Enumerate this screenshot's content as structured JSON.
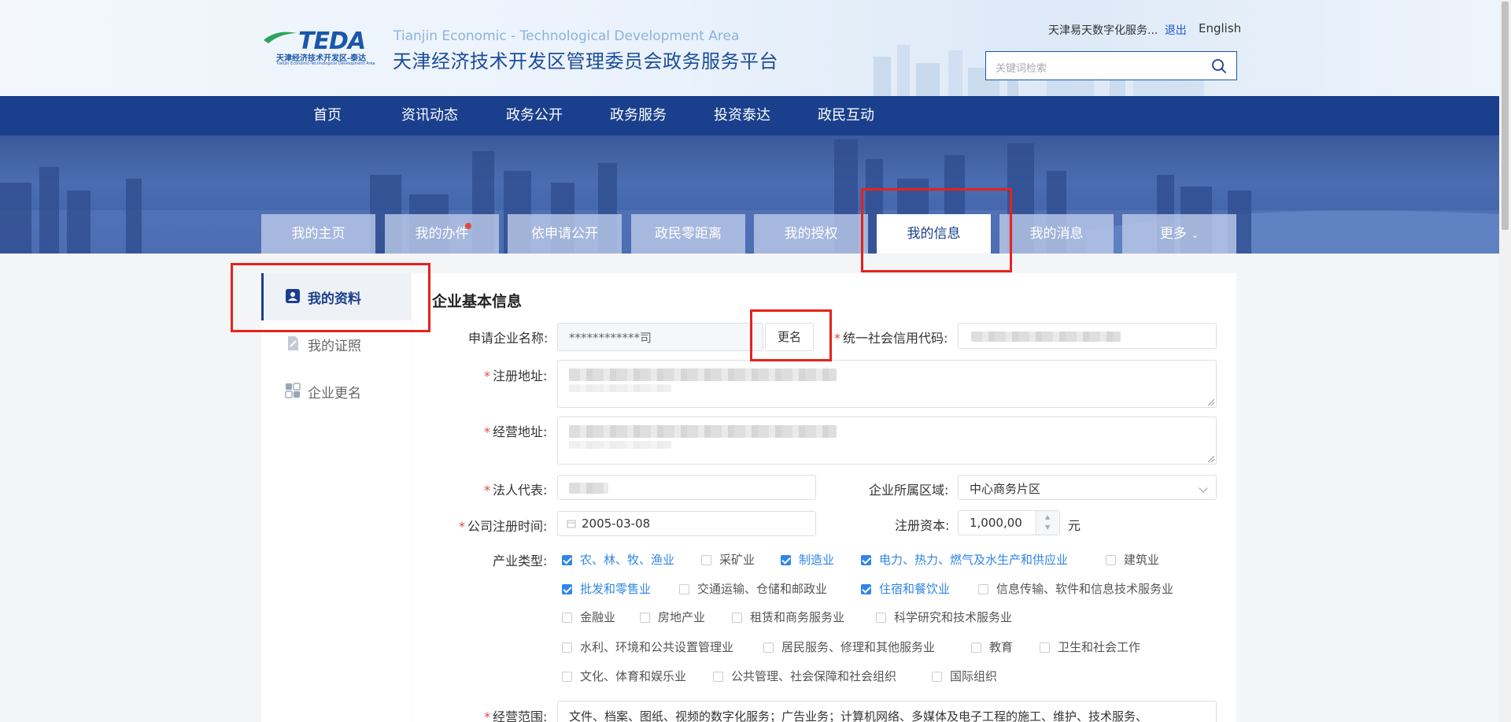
{
  "header": {
    "logo_text": "TEDA",
    "logo_sub_cn": "天津经济技术开发区-泰达",
    "logo_sub_en": "Tianjin Economic-Technological Development Area",
    "site_title_en": "Tianjin Economic - Technological Development Area",
    "site_title_cn": "天津经济技术开发区管理委员会政务服务平台",
    "user_name": "天津易天数字化服务...",
    "logout_label": "退出",
    "language_label": "English",
    "search_placeholder": "关键词检索"
  },
  "nav": {
    "items": [
      "首页",
      "资讯动态",
      "政务公开",
      "政务服务",
      "投资泰达",
      "政民互动"
    ]
  },
  "tabs": {
    "items": [
      "我的主页",
      "我的办件",
      "依申请公开",
      "政民零距离",
      "我的授权",
      "我的信息",
      "我的消息",
      "更多"
    ],
    "active": "我的信息"
  },
  "sidebar": {
    "items": [
      {
        "label": "我的资料",
        "icon": "id-card-icon"
      },
      {
        "label": "我的证照",
        "icon": "certificate-icon"
      },
      {
        "label": "企业更名",
        "icon": "rename-icon"
      }
    ],
    "active": "我的资料"
  },
  "form": {
    "section_title": "企业基本信息",
    "company_name_label": "申请企业名称:",
    "company_name_value": "************司",
    "rename_button": "更名",
    "credit_code_label": "统一社会信用代码:",
    "reg_address_label": "注册地址:",
    "biz_address_label": "经营地址:",
    "legal_rep_label": "法人代表:",
    "region_label": "企业所属区域:",
    "region_value": "中心商务片区",
    "reg_date_label": "公司注册时间:",
    "reg_date_value": "2005-03-08",
    "capital_label": "注册资本:",
    "capital_value": "1,000,00",
    "capital_unit": "元",
    "industry_label": "产业类型:",
    "industries": [
      {
        "label": "农、林、牧、渔业",
        "checked": true
      },
      {
        "label": "采矿业",
        "checked": false
      },
      {
        "label": "制造业",
        "checked": true
      },
      {
        "label": "电力、热力、燃气及水生产和供应业",
        "checked": true
      },
      {
        "label": "建筑业",
        "checked": false
      },
      {
        "label": "批发和零售业",
        "checked": true
      },
      {
        "label": "交通运输、仓储和邮政业",
        "checked": false
      },
      {
        "label": "住宿和餐饮业",
        "checked": true
      },
      {
        "label": "信息传输、软件和信息技术服务业",
        "checked": false
      },
      {
        "label": "金融业",
        "checked": false
      },
      {
        "label": "房地产业",
        "checked": false
      },
      {
        "label": "租赁和商务服务业",
        "checked": false
      },
      {
        "label": "科学研究和技术服务业",
        "checked": false
      },
      {
        "label": "水利、环境和公共设置管理业",
        "checked": false
      },
      {
        "label": "居民服务、修理和其他服务业",
        "checked": false
      },
      {
        "label": "教育",
        "checked": false
      },
      {
        "label": "卫生和社会工作",
        "checked": false
      },
      {
        "label": "文化、体育和娱乐业",
        "checked": false
      },
      {
        "label": "公共管理、社会保障和社会组织",
        "checked": false
      },
      {
        "label": "国际组织",
        "checked": false
      }
    ],
    "scope_label": "经营范围:",
    "scope_value": "文件、档案、图纸、视频的数字化服务；广告业务；计算机网络、多媒体及电子工程的施工、维护、技术服务、"
  },
  "colors": {
    "nav_bg": "#1a3f8c",
    "accent": "#2f86e8",
    "highlight": "#e8211b",
    "required": "#e8463d"
  }
}
